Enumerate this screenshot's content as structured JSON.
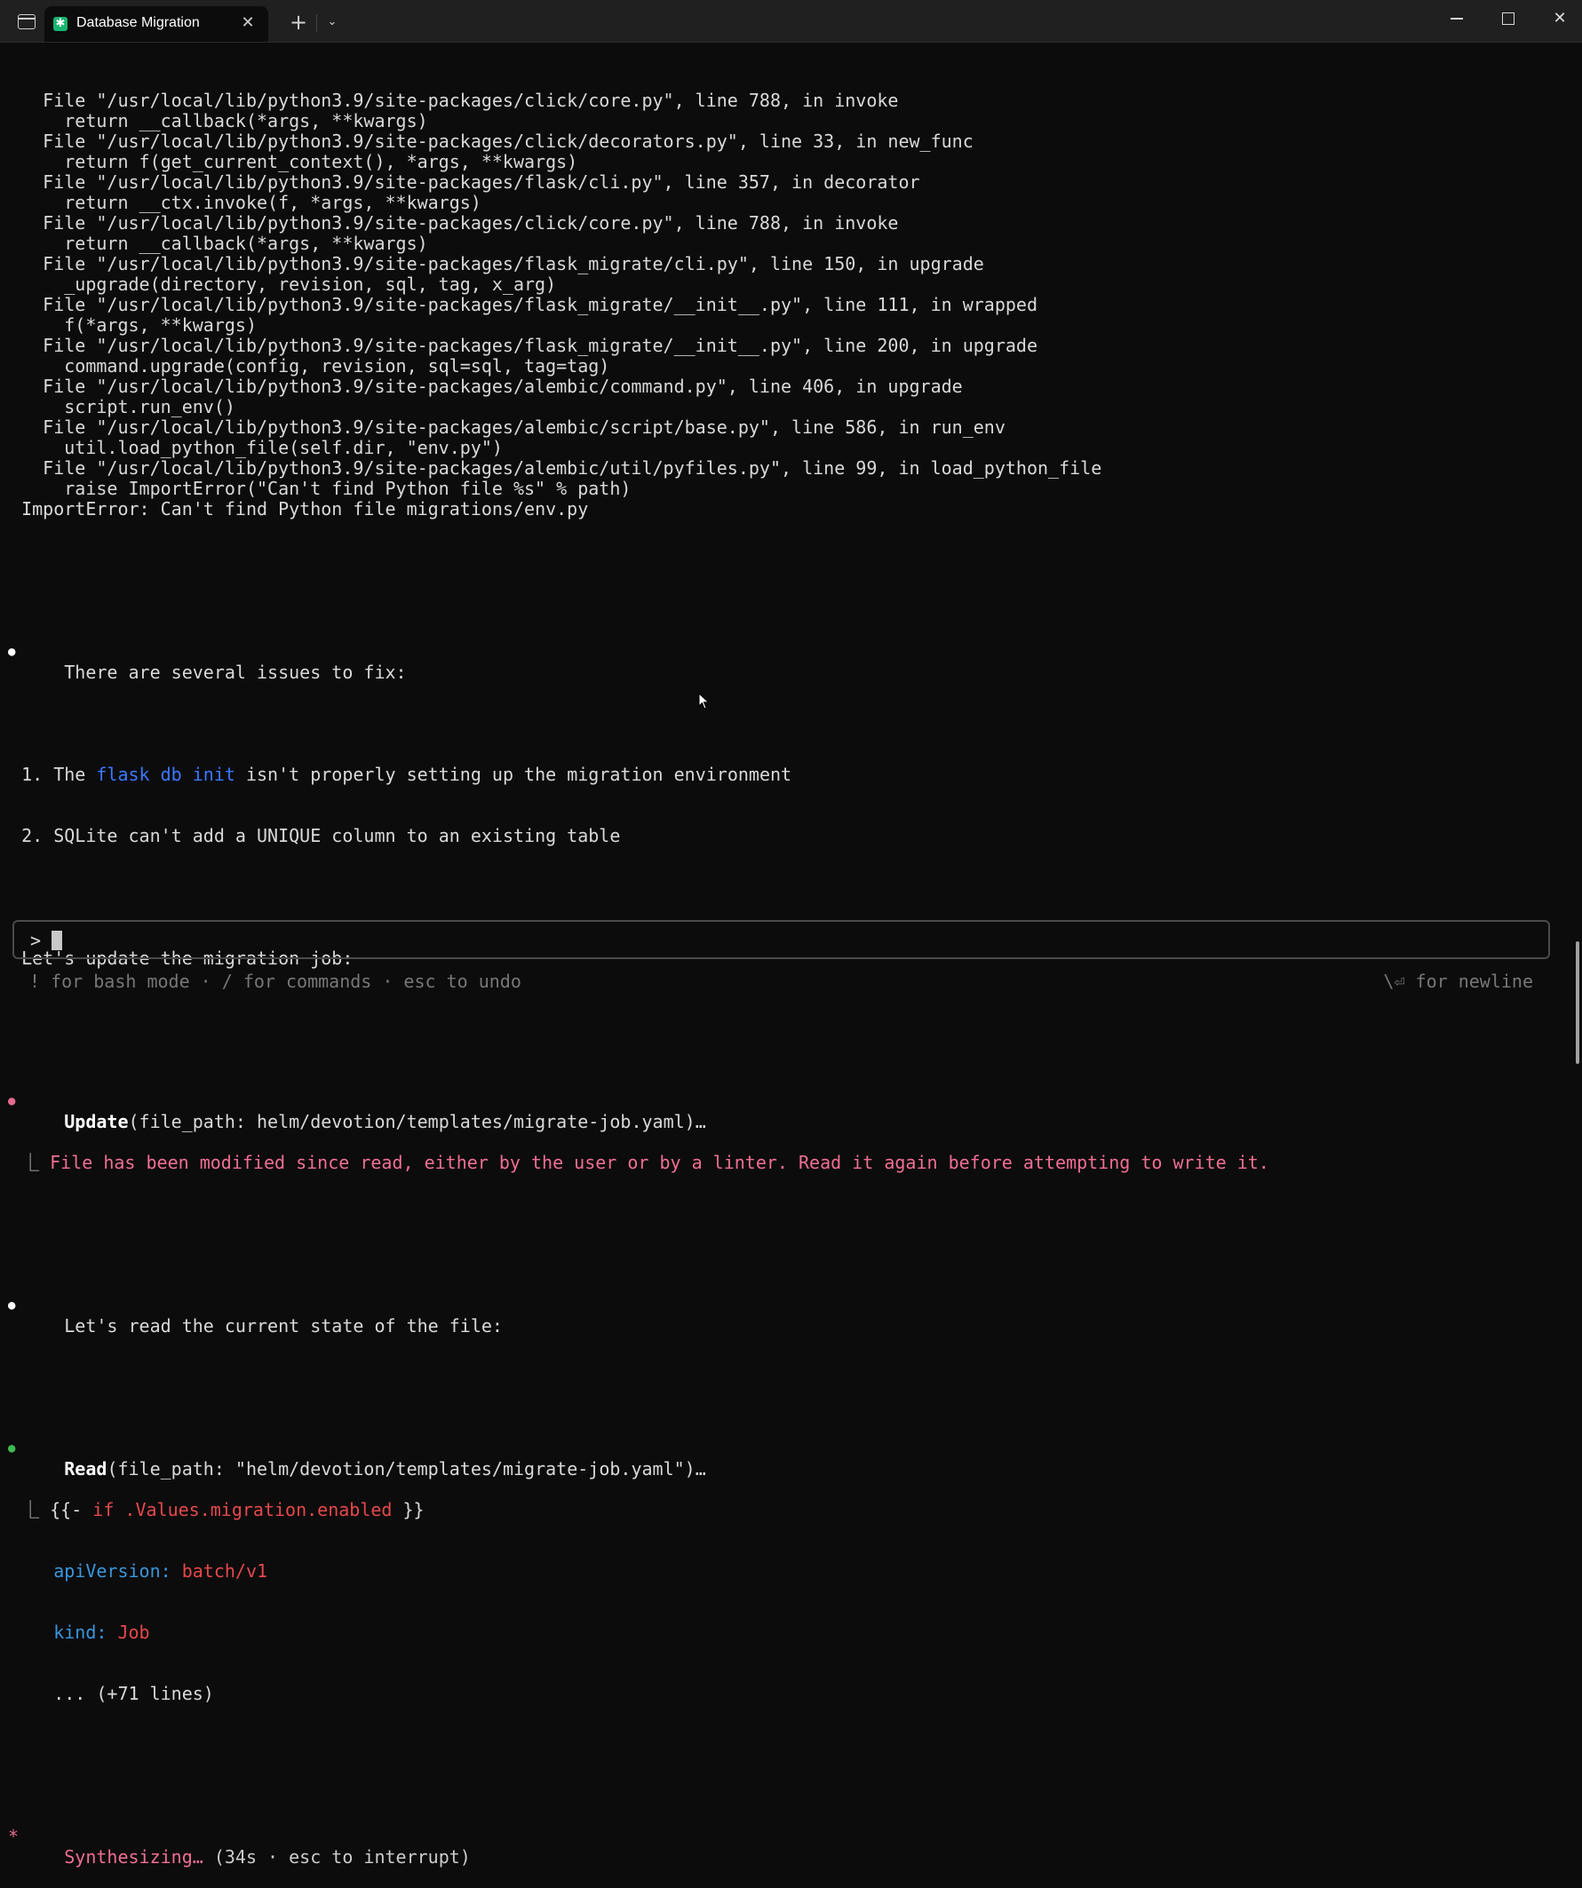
{
  "window": {
    "tab_title": "Database Migration",
    "tab_icon": "✱",
    "new_tab_label": "+",
    "dropdown_label": "⌄",
    "close_tab_label": "✕",
    "close_window_label": "✕"
  },
  "traceback": [
    {
      "indent": "  ",
      "text": "File \"/usr/local/lib/python3.9/site-packages/click/core.py\", line 788, in invoke"
    },
    {
      "indent": "    ",
      "text": "return __callback(*args, **kwargs)"
    },
    {
      "indent": "  ",
      "text": "File \"/usr/local/lib/python3.9/site-packages/click/decorators.py\", line 33, in new_func"
    },
    {
      "indent": "    ",
      "text": "return f(get_current_context(), *args, **kwargs)"
    },
    {
      "indent": "  ",
      "text": "File \"/usr/local/lib/python3.9/site-packages/flask/cli.py\", line 357, in decorator"
    },
    {
      "indent": "    ",
      "text": "return __ctx.invoke(f, *args, **kwargs)"
    },
    {
      "indent": "  ",
      "text": "File \"/usr/local/lib/python3.9/site-packages/click/core.py\", line 788, in invoke"
    },
    {
      "indent": "    ",
      "text": "return __callback(*args, **kwargs)"
    },
    {
      "indent": "  ",
      "text": "File \"/usr/local/lib/python3.9/site-packages/flask_migrate/cli.py\", line 150, in upgrade"
    },
    {
      "indent": "    ",
      "text": "_upgrade(directory, revision, sql, tag, x_arg)"
    },
    {
      "indent": "  ",
      "text": "File \"/usr/local/lib/python3.9/site-packages/flask_migrate/__init__.py\", line 111, in wrapped"
    },
    {
      "indent": "    ",
      "text": "f(*args, **kwargs)"
    },
    {
      "indent": "  ",
      "text": "File \"/usr/local/lib/python3.9/site-packages/flask_migrate/__init__.py\", line 200, in upgrade"
    },
    {
      "indent": "    ",
      "text": "command.upgrade(config, revision, sql=sql, tag=tag)"
    },
    {
      "indent": "  ",
      "text": "File \"/usr/local/lib/python3.9/site-packages/alembic/command.py\", line 406, in upgrade"
    },
    {
      "indent": "    ",
      "text": "script.run_env()"
    },
    {
      "indent": "  ",
      "text": "File \"/usr/local/lib/python3.9/site-packages/alembic/script/base.py\", line 586, in run_env"
    },
    {
      "indent": "    ",
      "text": "util.load_python_file(self.dir, \"env.py\")"
    },
    {
      "indent": "  ",
      "text": "File \"/usr/local/lib/python3.9/site-packages/alembic/util/pyfiles.py\", line 99, in load_python_file"
    },
    {
      "indent": "    ",
      "text": "raise ImportError(\"Can't find Python file %s\" % path)"
    },
    {
      "indent": "",
      "text": "ImportError: Can't find Python file migrations/env.py"
    }
  ],
  "message1": {
    "bullet": "●",
    "text": "There are several issues to fix:",
    "item1_prefix": "1. The ",
    "item1_code": "flask db init",
    "item1_suffix": " isn't properly setting up the migration environment",
    "item2": "2. SQLite can't add a UNIQUE column to an existing table",
    "followup": "Let's update the migration job:"
  },
  "update_call": {
    "bullet": "●",
    "name": "Update",
    "args": "(file_path: helm/devotion/templates/migrate-job.yaml)…",
    "result_prefix": "⎿",
    "result": "File has been modified since read, either by the user or by a linter. Read it again before attempting to write it."
  },
  "message2": {
    "bullet": "●",
    "text": "Let's read the current state of the file:"
  },
  "read_call": {
    "bullet": "●",
    "name": "Read",
    "args": "(file_path: \"helm/devotion/templates/migrate-job.yaml\")…",
    "result_prefix": "⎿",
    "yaml_open": "{{-",
    "yaml_if": " if .Values.migration.enabled",
    "yaml_close": " }}",
    "api_key": "apiVersion:",
    "api_val": " batch/v1",
    "kind_key": "kind:",
    "kind_val": " Job",
    "more": "... (+71 lines)"
  },
  "status": {
    "star": "*",
    "label": "Synthesizing…",
    "detail": " (34s · esc to interrupt)"
  },
  "input": {
    "prompt": ">",
    "value": ""
  },
  "hints": {
    "left": "! for bash mode · / for commands · esc to undo",
    "right": "\\⏎ for newline"
  },
  "colors": {
    "background": "#0c0c0c",
    "accent_pink": "#f06f94",
    "code_blue": "#3b78ff",
    "yaml_red": "#e5484d",
    "yaml_key": "#3a96dd",
    "success_green": "#3fb950",
    "tab_icon": "#18b470"
  }
}
